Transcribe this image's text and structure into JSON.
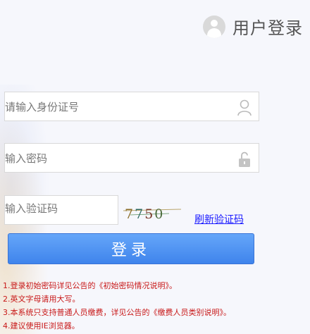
{
  "header": {
    "title": "用户登录",
    "avatar_icon": "user-avatar-icon"
  },
  "form": {
    "id_placeholder": "请输入身份证号",
    "id_icon": "person-icon",
    "password_placeholder": "输入密码",
    "password_icon": "lock-icon",
    "captcha_placeholder": "输入验证码",
    "captcha_text": "7750",
    "refresh_label": "刷新验证码",
    "login_label": "登录"
  },
  "notes": [
    "1.登录初始密码详见公告的《初始密码情况说明》。",
    "2.英文字母请用大写。",
    "3.本系统只支持普通人员缴费，详见公告的《缴费人员类别说明》。",
    "4.建议使用IE浏览器。"
  ],
  "colors": {
    "button": "#4a8ff1",
    "notes": "#c81818",
    "link": "#1a1aff"
  }
}
